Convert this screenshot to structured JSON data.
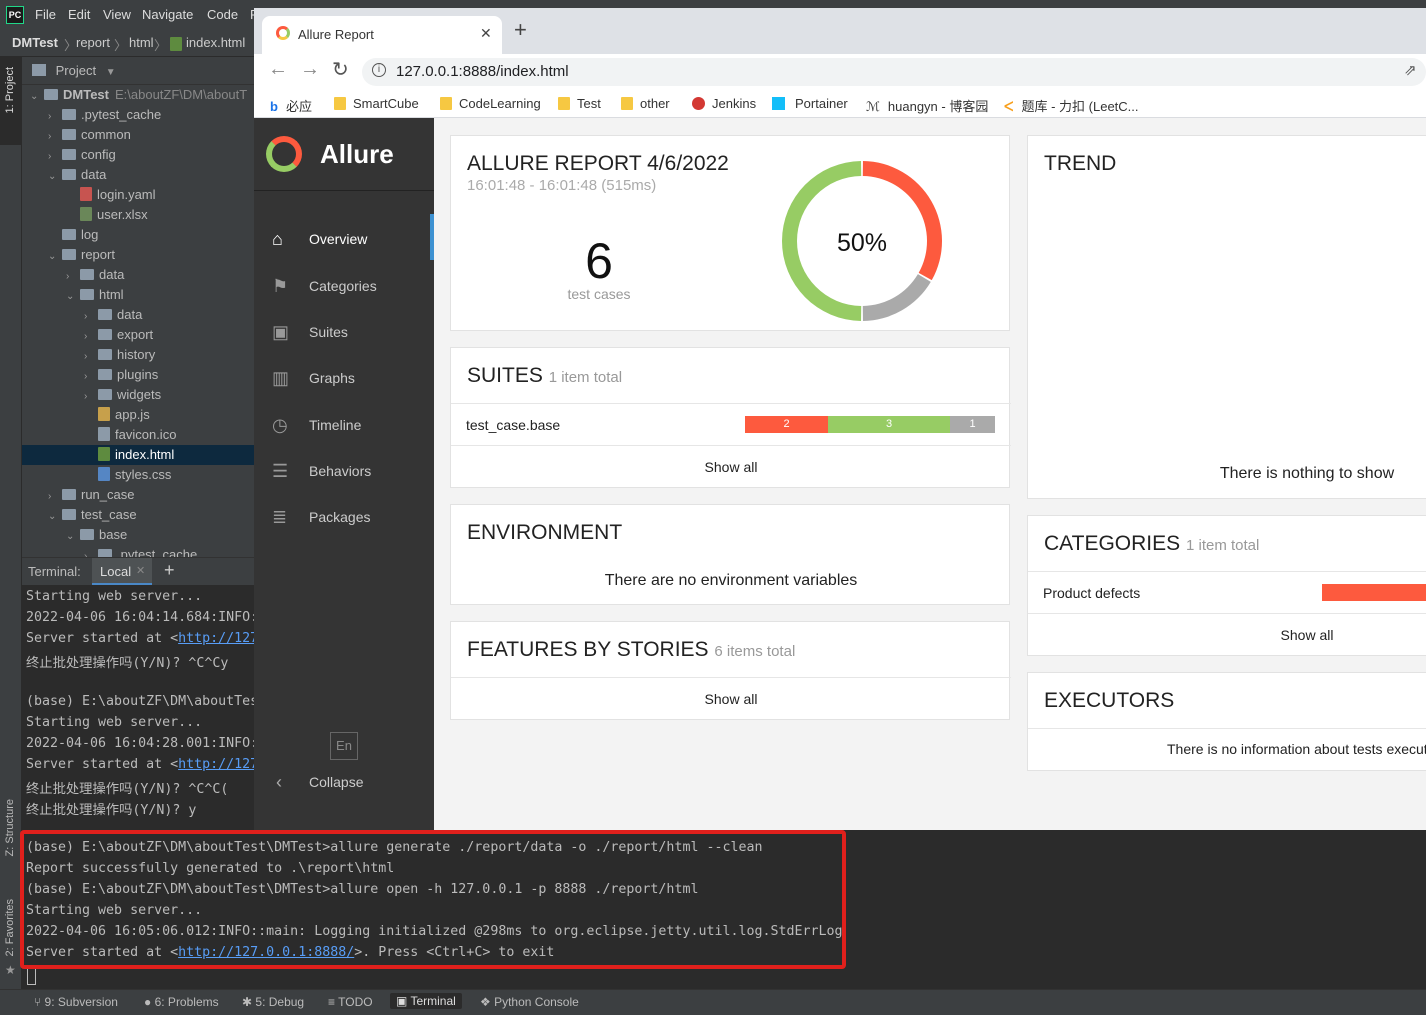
{
  "ide": {
    "logo": "PC",
    "menu": [
      "File",
      "Edit",
      "View",
      "Navigate",
      "Code",
      "R"
    ],
    "breadcrumbs": [
      "DMTest",
      "report",
      "html",
      "index.html"
    ],
    "left_tabs": [
      "1: Project",
      "Z: Structure",
      "2: Favorites"
    ],
    "project_header": "Project",
    "tree": [
      {
        "label": "DMTest",
        "extra": "E:\\aboutZF\\DM\\aboutT",
        "indent": 0,
        "arrow": "v",
        "type": "folder"
      },
      {
        "label": ".pytest_cache",
        "indent": 1,
        "arrow": ">",
        "type": "folder"
      },
      {
        "label": "common",
        "indent": 1,
        "arrow": ">",
        "type": "folder"
      },
      {
        "label": "config",
        "indent": 1,
        "arrow": ">",
        "type": "folder"
      },
      {
        "label": "data",
        "indent": 1,
        "arrow": "v",
        "type": "folder"
      },
      {
        "label": "login.yaml",
        "indent": 2,
        "arrow": "",
        "type": "yaml"
      },
      {
        "label": "user.xlsx",
        "indent": 2,
        "arrow": "",
        "type": "xlsx"
      },
      {
        "label": "log",
        "indent": 1,
        "arrow": "",
        "type": "folder"
      },
      {
        "label": "report",
        "indent": 1,
        "arrow": "v",
        "type": "folder"
      },
      {
        "label": "data",
        "indent": 2,
        "arrow": ">",
        "type": "folder"
      },
      {
        "label": "html",
        "indent": 2,
        "arrow": "v",
        "type": "folder"
      },
      {
        "label": "data",
        "indent": 3,
        "arrow": ">",
        "type": "folder"
      },
      {
        "label": "export",
        "indent": 3,
        "arrow": ">",
        "type": "folder"
      },
      {
        "label": "history",
        "indent": 3,
        "arrow": ">",
        "type": "folder"
      },
      {
        "label": "plugins",
        "indent": 3,
        "arrow": ">",
        "type": "folder"
      },
      {
        "label": "widgets",
        "indent": 3,
        "arrow": ">",
        "type": "folder"
      },
      {
        "label": "app.js",
        "indent": 3,
        "arrow": "",
        "type": "js"
      },
      {
        "label": "favicon.ico",
        "indent": 3,
        "arrow": "",
        "type": "ico"
      },
      {
        "label": "index.html",
        "indent": 3,
        "arrow": "",
        "type": "html",
        "selected": true
      },
      {
        "label": "styles.css",
        "indent": 3,
        "arrow": "",
        "type": "css"
      },
      {
        "label": "run_case",
        "indent": 1,
        "arrow": ">",
        "type": "folder"
      },
      {
        "label": "test_case",
        "indent": 1,
        "arrow": "v",
        "type": "folder"
      },
      {
        "label": "base",
        "indent": 2,
        "arrow": "v",
        "type": "folder"
      },
      {
        "label": ".pytest_cache",
        "indent": 3,
        "arrow": ">",
        "type": "folder"
      }
    ],
    "terminal": {
      "label": "Terminal:",
      "tab": "Local",
      "narrow_lines": [
        {
          "text": "Starting web server..."
        },
        {
          "text": "2022-04-06 16:04:14.684:INFO:"
        },
        {
          "pre": "Server started at <",
          "link": "http://127"
        },
        {
          "text": "终止批处理操作吗(Y/N)? ^C^Cy"
        },
        {
          "text": ""
        },
        {
          "text": "(base) E:\\aboutZF\\DM\\aboutTes"
        },
        {
          "text": "Starting web server..."
        },
        {
          "text": "2022-04-06 16:04:28.001:INFO:"
        },
        {
          "pre": "Server started at <",
          "link": "http://127"
        },
        {
          "text": "终止批处理操作吗(Y/N)? ^C^C("
        },
        {
          "text": "终止批处理操作吗(Y/N)? y"
        }
      ],
      "full_lines": [
        {
          "text": "(base) E:\\aboutZF\\DM\\aboutTest\\DMTest>allure generate ./report/data -o ./report/html --clean"
        },
        {
          "text": "Report successfully generated to .\\report\\html"
        },
        {
          "text": "(base) E:\\aboutZF\\DM\\aboutTest\\DMTest>allure open -h 127.0.0.1 -p 8888 ./report/html"
        },
        {
          "text": "Starting web server..."
        },
        {
          "text": "2022-04-06 16:05:06.012:INFO::main: Logging initialized @298ms to org.eclipse.jetty.util.log.StdErrLog"
        },
        {
          "pre": "Server started at <",
          "link": "http://127.0.0.1:8888/",
          "post": ">. Press <Ctrl+C> to exit"
        }
      ]
    },
    "statusbar": [
      "9: Subversion",
      "6: Problems",
      "5: Debug",
      "TODO",
      "Terminal",
      "Python Console"
    ]
  },
  "browser": {
    "tab_title": "Allure Report",
    "url": "127.0.0.1:8888/index.html",
    "bookmarks": [
      "必应",
      "SmartCube",
      "CodeLearning",
      "Test",
      "other",
      "Jenkins",
      "Portainer",
      "huangyn - 博客园",
      "题库 - 力扣 (LeetC..."
    ]
  },
  "allure": {
    "brand": "Allure",
    "nav": [
      "Overview",
      "Categories",
      "Suites",
      "Graphs",
      "Timeline",
      "Behaviors",
      "Packages"
    ],
    "lang": "En",
    "collapse": "Collapse",
    "summary": {
      "title": "ALLURE REPORT 4/6/2022",
      "time": "16:01:48 - 16:01:48 (515ms)",
      "count": "6",
      "count_label": "test cases",
      "percent": "50%",
      "donut": {
        "failed": 2,
        "passed": 3,
        "unknown": 1
      }
    },
    "trend": {
      "title": "TREND",
      "empty": "There is nothing to show"
    },
    "suites": {
      "title": "SUITES",
      "total": "1 item total",
      "row": "test_case.base",
      "bar": {
        "failed": "2",
        "passed": "3",
        "unknown": "1"
      },
      "show_all": "Show all"
    },
    "environment": {
      "title": "ENVIRONMENT",
      "empty": "There are no environment variables"
    },
    "features": {
      "title": "FEATURES BY STORIES",
      "total": "6 items total",
      "show_all": "Show all"
    },
    "categories": {
      "title": "CATEGORIES",
      "total": "1 item total",
      "row": "Product defects",
      "show_all": "Show all"
    },
    "executors": {
      "title": "EXECUTORS",
      "empty": "There is no information about tests executors"
    },
    "colors": {
      "failed": "#fd5a3e",
      "passed": "#97cc64",
      "unknown": "#aaaaaa",
      "sidebar": "#343434"
    }
  }
}
